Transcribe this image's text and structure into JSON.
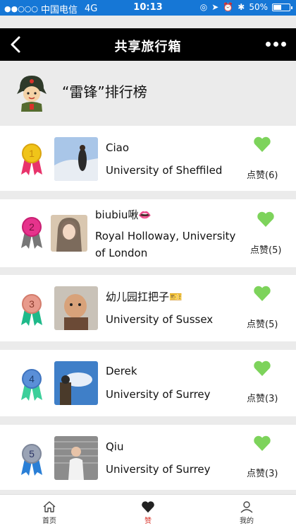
{
  "status_bar": {
    "carrier": "中国电信",
    "network": "4G",
    "time": "10:13",
    "battery": "50%",
    "battery_level": 0.5
  },
  "nav": {
    "title": "共享旅行箱"
  },
  "header": {
    "title": "“雷锋”排行榜"
  },
  "ranking": [
    {
      "rank": "1",
      "name": "Ciao",
      "school": "University of Sheffiled",
      "likes": "点赞(6)",
      "medal_color": "#f0c419",
      "ribbon_color": "#e8336b"
    },
    {
      "rank": "2",
      "name": "biubiu啾👄",
      "school": "Royal Holloway, University of London",
      "likes": "点赞(5)",
      "medal_color": "#e6338c",
      "ribbon_color": "#777777"
    },
    {
      "rank": "3",
      "name": "幼儿园扛把子🎫",
      "school": "University of Sussex",
      "likes": "点赞(5)",
      "medal_color": "#e89a8c",
      "ribbon_color": "#1fb98a"
    },
    {
      "rank": "4",
      "name": "Derek",
      "school": "University of Surrey",
      "likes": "点赞(3)",
      "medal_color": "#5a8fd8",
      "ribbon_color": "#3ccf9a"
    },
    {
      "rank": "5",
      "name": "Qiu",
      "school": "University of Surrey",
      "likes": "点赞(3)",
      "medal_color": "#9aa3b5",
      "ribbon_color": "#2a7fd6"
    }
  ],
  "tabs": [
    {
      "label": "首页",
      "icon": "home-icon"
    },
    {
      "label": "赞",
      "icon": "heart-icon"
    },
    {
      "label": "我的",
      "icon": "user-icon"
    }
  ],
  "colors": {
    "status_bar": "#1677d6",
    "nav_bar": "#000000",
    "like_heart": "#7dd35b",
    "active_tab": "#d9342b"
  }
}
